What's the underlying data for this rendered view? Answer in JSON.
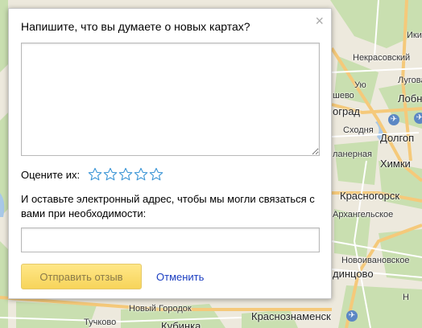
{
  "dialog": {
    "title": "Напишите, что вы думаете о новых картах?",
    "close_label": "×",
    "comment_value": "",
    "rating_label": "Оцените их:",
    "rating_value": 0,
    "rating_max": 5,
    "email_label": "И оставьте электронный адрес, чтобы мы могли связаться с вами при необходимости:",
    "email_value": "",
    "submit_label": "Отправить отзыв",
    "cancel_label": "Отменить"
  },
  "map": {
    "labels": {
      "ikshi": "Ики",
      "nekrasovsky": "Некрасовский",
      "lugovaya": "Лугова",
      "uvo": "Ую",
      "shevo": "шево",
      "lobnya": "Лобн",
      "ograd": "оград",
      "shodnya": "Сходня",
      "dolgoprudny": "Долгоп",
      "planernaya": "ланерная",
      "khimki": "Химки",
      "krasnogorsk": "Красногорск",
      "arkhangelskoe": "Архангельское",
      "novoivanovskoe": "Новоивановское",
      "odintsovo": "динцово",
      "noviy_gorodok": "Новый Городок",
      "tuchkovo": "Тучково",
      "krasnoznamensk": "Краснознаменск",
      "kubinka": "Кубинка",
      "nmr": "Н"
    },
    "colors": {
      "land": "#ede9dd",
      "forest": "#c9dfb0",
      "road_major": "#f5c97a",
      "road_minor": "#ffffff",
      "water": "#a8c8e8"
    }
  }
}
